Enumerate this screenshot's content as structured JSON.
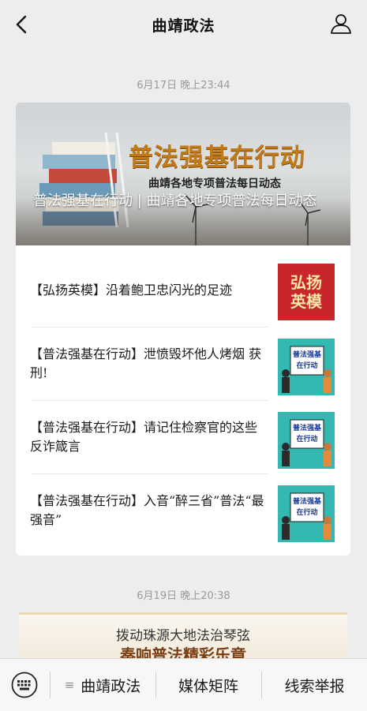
{
  "header": {
    "title": "曲靖政法"
  },
  "messages": [
    {
      "time": "6月17日 晚上23:44",
      "hero": {
        "big_title": "普法强基在行动",
        "sub_title": "曲靖各地专项普法每日动态",
        "caption": "普法强基在行动 | 曲靖各地专项普法每日动态"
      },
      "items": [
        {
          "title": "【弘扬英模】沿着鲍卫忠闪光的足迹",
          "thumb_text": [
            "弘扬",
            "英模"
          ]
        },
        {
          "title": "【普法强基在行动】泄愤毁坏他人烤烟 获刑!",
          "thumb_text": [
            "普法强基",
            "在行动"
          ]
        },
        {
          "title": "【普法强基在行动】请记住检察官的这些反诈箴言",
          "thumb_text": [
            "普法强基",
            "在行动"
          ]
        },
        {
          "title": "【普法强基在行动】入音“醉三省”普法“最强音”",
          "thumb_text": [
            "普法强基",
            "在行动"
          ]
        }
      ]
    },
    {
      "time": "6月19日 晚上20:38",
      "banner": {
        "line1": "拨动珠源大地法治琴弦",
        "line2": "奏响普法精彩乐章"
      }
    }
  ],
  "bottom_menu": [
    {
      "label": "曲靖政法",
      "has_list_icon": true
    },
    {
      "label": "媒体矩阵"
    },
    {
      "label": "线索举报"
    }
  ],
  "colors": {
    "background": "#ededed",
    "accent_red": "#c8262b",
    "thumb_teal": "#35b8b1",
    "hero_gold": "#c07a1a"
  },
  "icons": [
    "back-arrow-icon",
    "profile-icon",
    "keyboard-icon",
    "list-icon"
  ]
}
